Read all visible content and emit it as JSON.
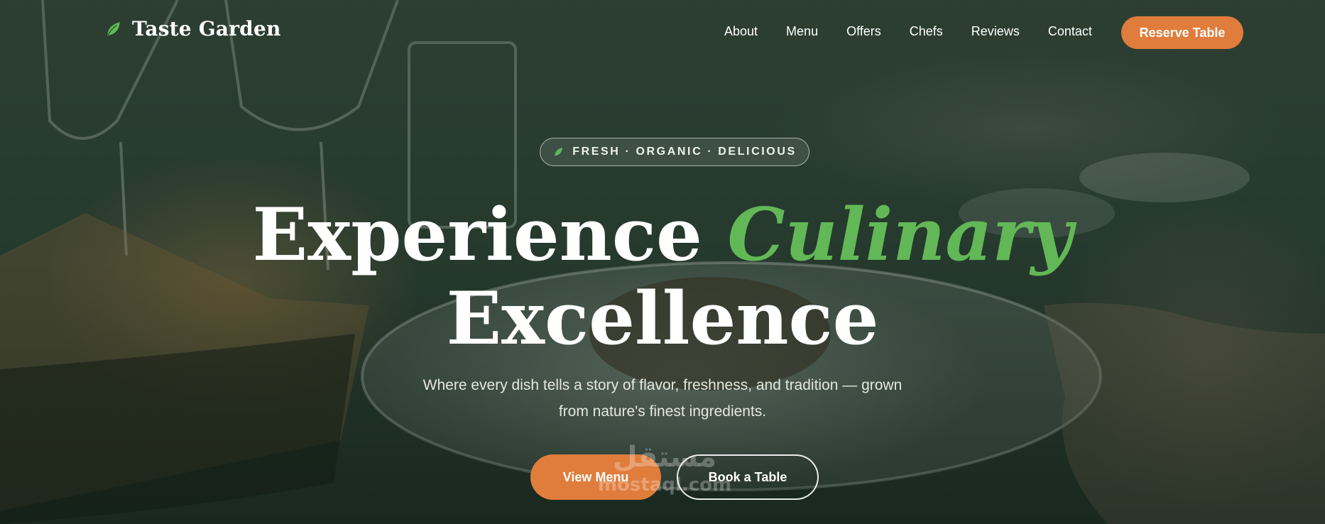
{
  "brand": {
    "name": "Taste Garden",
    "accent_green": "#62b856",
    "accent_orange": "#e07d3c"
  },
  "nav": {
    "links": [
      "About",
      "Menu",
      "Offers",
      "Chefs",
      "Reviews",
      "Contact"
    ],
    "cta_label": "Reserve Table"
  },
  "hero": {
    "badge_icon": "leaf-icon",
    "badge_text": "FRESH · ORGANIC · DELICIOUS",
    "headline_part1": "Experience",
    "headline_accent": "Culinary",
    "headline_part2": "Excellence",
    "subtext": "Where every dish tells a story of flavor, freshness, and tradition — grown from nature's finest ingredients.",
    "primary_button": "View Menu",
    "secondary_button": "Book a Table"
  },
  "watermark": {
    "arabic": "مستقل",
    "latin": "mostaql.com"
  }
}
